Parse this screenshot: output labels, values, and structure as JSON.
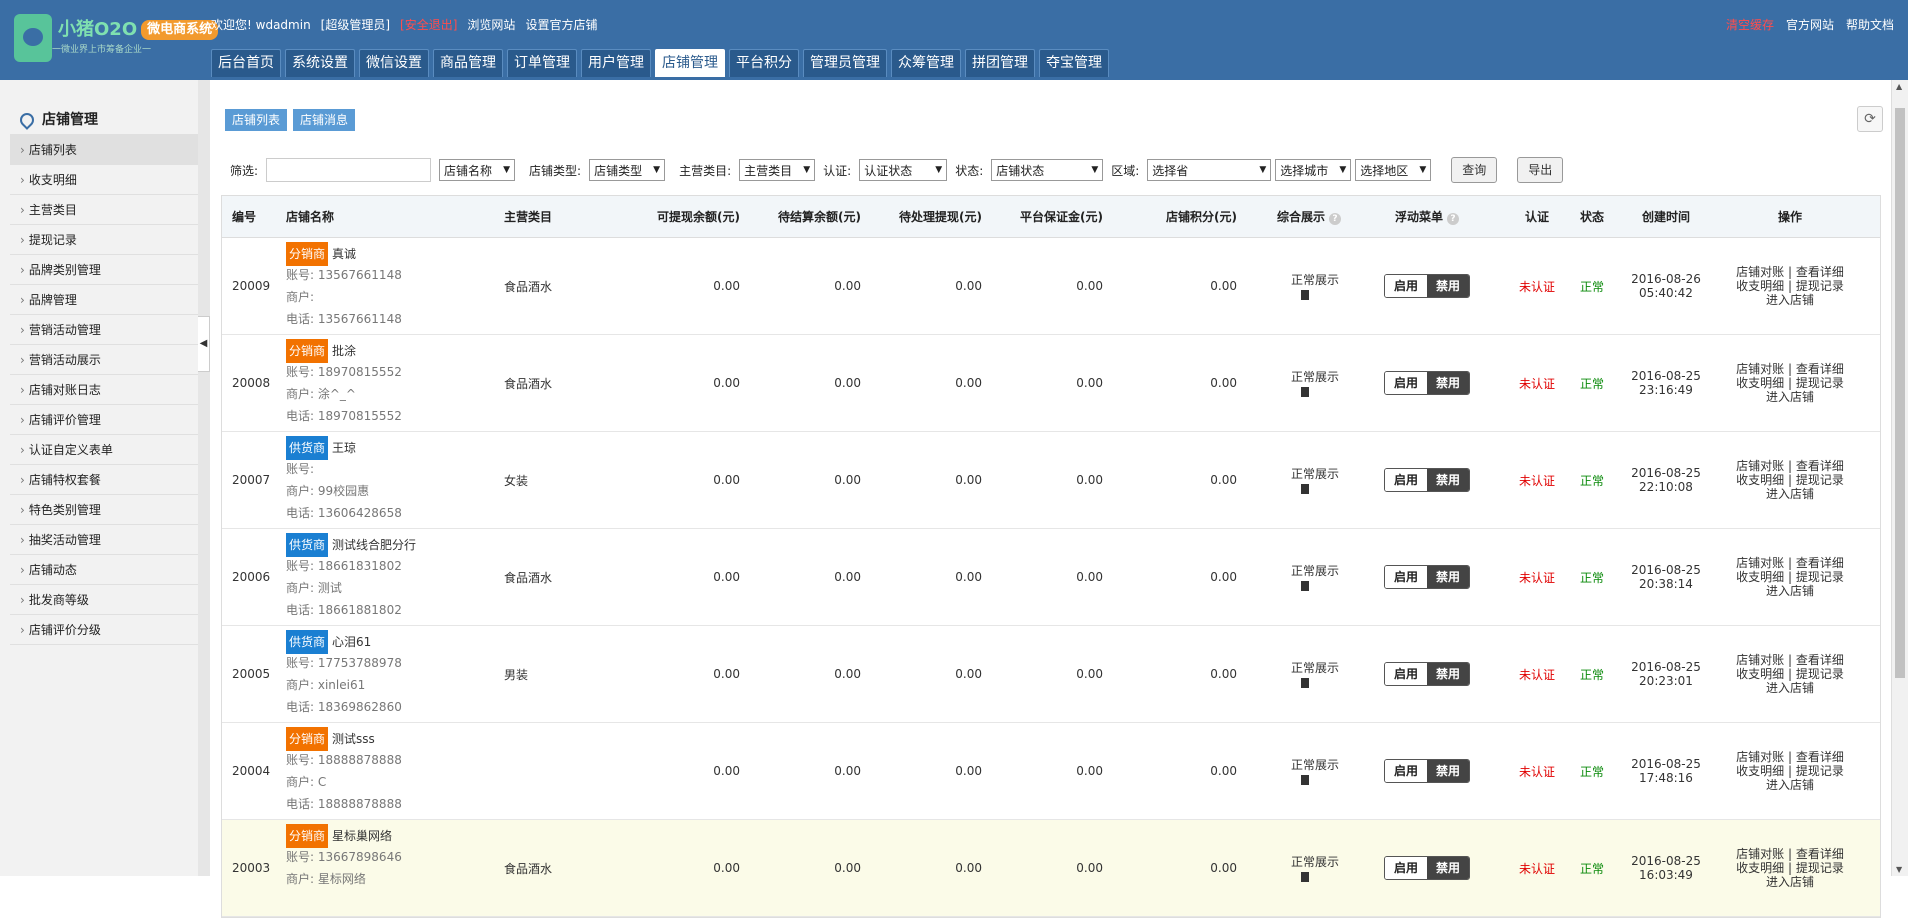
{
  "header": {
    "logo_text": "小猪O2O",
    "logo_badge": "微电商系统",
    "logo_sub": "一微业界上市筹备企业一",
    "welcome": "欢迎您!",
    "username": "wdadmin",
    "role": "[超级管理员]",
    "logout": "[安全退出]",
    "browse_site": "浏览网站",
    "set_official": "设置官方店铺",
    "clear_cache": "清空缓存",
    "official_site": "官方网站",
    "help_docs": "帮助文档"
  },
  "nav": {
    "tabs": [
      "后台首页",
      "系统设置",
      "微信设置",
      "商品管理",
      "订单管理",
      "用户管理",
      "店铺管理",
      "平台积分",
      "管理员管理",
      "众筹管理",
      "拼团管理",
      "夺宝管理"
    ],
    "active": "店铺管理"
  },
  "sidebar": {
    "title": "店铺管理",
    "items": [
      "店铺列表",
      "收支明细",
      "主营类目",
      "提现记录",
      "品牌类别管理",
      "品牌管理",
      "营销活动管理",
      "营销活动展示",
      "店铺对账日志",
      "店铺评价管理",
      "认证自定义表单",
      "店铺特权套餐",
      "特色类别管理",
      "抽奖活动管理",
      "店铺动态",
      "批发商等级",
      "店铺评价分级"
    ],
    "active": "店铺列表"
  },
  "subtabs": [
    "店铺列表",
    "店铺消息"
  ],
  "filter": {
    "label": "筛选:",
    "keyword_value": "",
    "name_select": "店铺名称",
    "type_label": "店铺类型:",
    "type_select": "店铺类型",
    "cat_label": "主营类目:",
    "cat_select": "主营类目",
    "auth_label": "认证:",
    "auth_select": "认证状态",
    "status_label": "状态:",
    "status_select": "店铺状态",
    "region_label": "区域:",
    "province_select": "选择省",
    "city_select": "选择城市",
    "district_select": "选择地区",
    "query_button": "查询",
    "export_button": "导出"
  },
  "table": {
    "headers": {
      "id": "编号",
      "name": "店铺名称",
      "category": "主营类目",
      "withdrawable": "可提现余额(元)",
      "pending_settle": "待结算余额(元)",
      "pending_withdraw": "待处理提现(元)",
      "deposit": "平台保证金(元)",
      "points": "店铺积分(元)",
      "display": "综合展示",
      "float_menu": "浮动菜单",
      "auth": "认证",
      "status": "状态",
      "created": "创建时间",
      "ops": "操作"
    },
    "rows": [
      {
        "id": "20009",
        "badge": "分销商",
        "badge_type": "fx",
        "name": "真诚",
        "account": "账号: 13567661148",
        "merchant": "商户:",
        "phone": "电话: 13567661148",
        "category": "食品酒水",
        "v1": "0.00",
        "v2": "0.00",
        "v3": "0.00",
        "v4": "0.00",
        "v5": "0.00",
        "display": "正常展示",
        "on": "启用",
        "off": "禁用",
        "auth": "未认证",
        "status": "正常",
        "date": "2016-08-26",
        "time": "05:40:42",
        "op1": "店铺对账 | 查看详细",
        "op2": "收支明细 | 提现记录",
        "op3": "进入店铺"
      },
      {
        "id": "20008",
        "badge": "分销商",
        "badge_type": "fx",
        "name": "批涂",
        "account": "账号: 18970815552",
        "merchant": "商户: 涂^_^",
        "phone": "电话: 18970815552",
        "category": "食品酒水",
        "v1": "0.00",
        "v2": "0.00",
        "v3": "0.00",
        "v4": "0.00",
        "v5": "0.00",
        "display": "正常展示",
        "on": "启用",
        "off": "禁用",
        "auth": "未认证",
        "status": "正常",
        "date": "2016-08-25",
        "time": "23:16:49",
        "op1": "店铺对账 | 查看详细",
        "op2": "收支明细 | 提现记录",
        "op3": "进入店铺"
      },
      {
        "id": "20007",
        "badge": "供货商",
        "badge_type": "gh",
        "name": "王琼",
        "account": "账号:",
        "merchant": "商户: 99校园惠",
        "phone": "电话: 13606428658",
        "category": "女装",
        "v1": "0.00",
        "v2": "0.00",
        "v3": "0.00",
        "v4": "0.00",
        "v5": "0.00",
        "display": "正常展示",
        "on": "启用",
        "off": "禁用",
        "auth": "未认证",
        "status": "正常",
        "date": "2016-08-25",
        "time": "22:10:08",
        "op1": "店铺对账 | 查看详细",
        "op2": "收支明细 | 提现记录",
        "op3": "进入店铺"
      },
      {
        "id": "20006",
        "badge": "供货商",
        "badge_type": "gh",
        "name": "测试线合肥分行",
        "account": "账号: 18661831802",
        "merchant": "商户: 测试",
        "phone": "电话: 18661881802",
        "category": "食品酒水",
        "v1": "0.00",
        "v2": "0.00",
        "v3": "0.00",
        "v4": "0.00",
        "v5": "0.00",
        "display": "正常展示",
        "on": "启用",
        "off": "禁用",
        "auth": "未认证",
        "status": "正常",
        "date": "2016-08-25",
        "time": "20:38:14",
        "op1": "店铺对账 | 查看详细",
        "op2": "收支明细 | 提现记录",
        "op3": "进入店铺"
      },
      {
        "id": "20005",
        "badge": "供货商",
        "badge_type": "gh",
        "name": "心泪61",
        "account": "账号: 17753788978",
        "merchant": "商户: xinlei61",
        "phone": "电话: 18369862860",
        "category": "男装",
        "v1": "0.00",
        "v2": "0.00",
        "v3": "0.00",
        "v4": "0.00",
        "v5": "0.00",
        "display": "正常展示",
        "on": "启用",
        "off": "禁用",
        "auth": "未认证",
        "status": "正常",
        "date": "2016-08-25",
        "time": "20:23:01",
        "op1": "店铺对账 | 查看详细",
        "op2": "收支明细 | 提现记录",
        "op3": "进入店铺"
      },
      {
        "id": "20004",
        "badge": "分销商",
        "badge_type": "fx",
        "name": "测试sss",
        "account": "账号: 18888878888",
        "merchant": "商户: C",
        "phone": "电话: 18888878888",
        "category": "",
        "v1": "0.00",
        "v2": "0.00",
        "v3": "0.00",
        "v4": "0.00",
        "v5": "0.00",
        "display": "正常展示",
        "on": "启用",
        "off": "禁用",
        "auth": "未认证",
        "status": "正常",
        "date": "2016-08-25",
        "time": "17:48:16",
        "op1": "店铺对账 | 查看详细",
        "op2": "收支明细 | 提现记录",
        "op3": "进入店铺"
      },
      {
        "id": "20003",
        "badge": "分销商",
        "badge_type": "fx",
        "name": "星标巢网络",
        "account": "账号: 13667898646",
        "merchant": "商户: 星标网络",
        "phone": "",
        "category": "食品酒水",
        "v1": "0.00",
        "v2": "0.00",
        "v3": "0.00",
        "v4": "0.00",
        "v5": "0.00",
        "display": "正常展示",
        "on": "启用",
        "off": "禁用",
        "auth": "未认证",
        "status": "正常",
        "date": "2016-08-25",
        "time": "16:03:49",
        "op1": "店铺对账 | 查看详细",
        "op2": "收支明细 | 提现记录",
        "op3": "进入店铺"
      }
    ]
  }
}
